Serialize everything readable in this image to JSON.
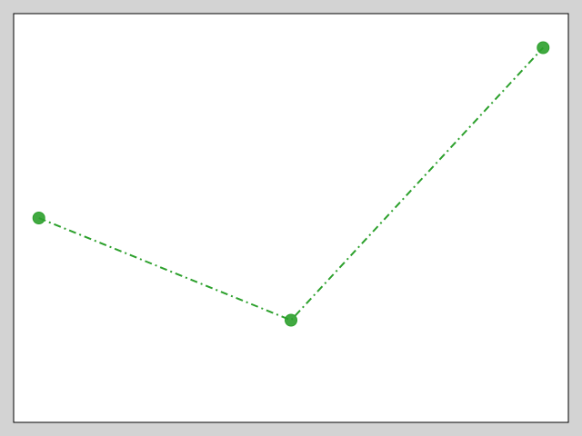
{
  "chart_data": {
    "type": "line",
    "title": "",
    "xlabel": "",
    "ylabel": "",
    "x": [
      0,
      1,
      2
    ],
    "xlim": [
      -0.1,
      2.1
    ],
    "ylim": [
      -0.1,
      1.1
    ],
    "grid": false,
    "series": [
      {
        "values": [
          0.5,
          0.2,
          1.0
        ],
        "color": "#2ca02c",
        "line_style": "dash-dot",
        "marker": "circle"
      }
    ]
  },
  "colors": {
    "figure_background": "#d3d3d3",
    "plot_background": "#ffffff",
    "axes_edge": "#000000"
  }
}
